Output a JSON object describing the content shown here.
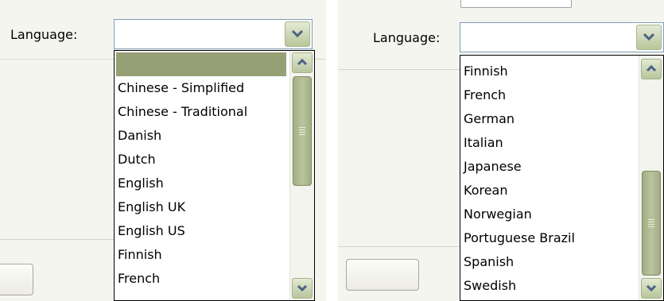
{
  "left_panel": {
    "language_label": "Language:",
    "selected_value": "",
    "items": [
      "",
      "Chinese - Simplified",
      "Chinese - Traditional",
      "Danish",
      "Dutch",
      "English",
      "English UK",
      "English US",
      "Finnish",
      "French"
    ],
    "scroll_position": 0.0
  },
  "right_panel": {
    "language_label": "Language:",
    "selected_value": "",
    "items": [
      "Finnish",
      "French",
      "German",
      "Italian",
      "Japanese",
      "Korean",
      "Norwegian",
      "Portuguese Brazil",
      "Spanish",
      "Swedish"
    ],
    "scroll_position": 1.0
  },
  "icons": {
    "dropdown": "chevron-down-icon",
    "scroll_up": "chevron-up-icon",
    "scroll_down": "chevron-down-icon",
    "thumb_grip": "grip-lines-icon"
  },
  "colors": {
    "selected_item_bg": "#96a075",
    "scrollbar_thumb": "#b3be94",
    "arrow": "#4d6185",
    "panel_bg": "#f5f5f0"
  }
}
